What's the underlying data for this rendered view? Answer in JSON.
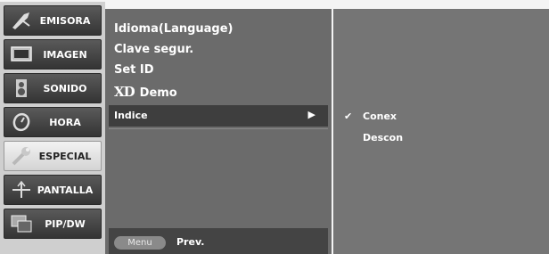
{
  "tabs": [
    {
      "label": "EMISORA",
      "icon": "satellite-dish-icon"
    },
    {
      "label": "IMAGEN",
      "icon": "picture-screen-icon"
    },
    {
      "label": "SONIDO",
      "icon": "speaker-icon"
    },
    {
      "label": "HORA",
      "icon": "clock-icon"
    },
    {
      "label": "ESPECIAL",
      "icon": "wrench-icon"
    },
    {
      "label": "PANTALLA",
      "icon": "screen-adjust-icon"
    },
    {
      "label": "PIP/DW",
      "icon": "pip-icon"
    }
  ],
  "active_tab": "ESPECIAL",
  "menu": {
    "items": [
      "Idioma(Language)",
      "Clave segur.",
      "Set ID",
      "Demo"
    ],
    "demo_logo": "XD",
    "selected": "Indice",
    "selected_arrow": "▶"
  },
  "submenu": {
    "check_mark": "✔",
    "options": [
      "Conex",
      "Descon"
    ],
    "selected": "Conex"
  },
  "footer": {
    "menu_label": "Menu",
    "prev_label": "Prev."
  },
  "colors": {
    "background": "#f4f4f4",
    "menu_panel": "#6b6b6b",
    "submenu_panel": "#757575",
    "selected_row": "#3e3e3e"
  }
}
